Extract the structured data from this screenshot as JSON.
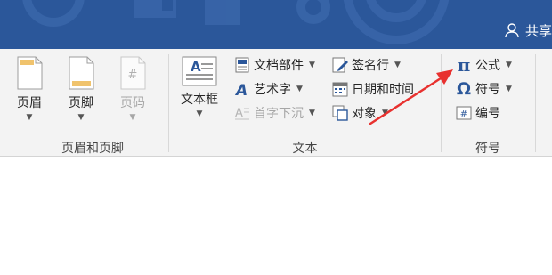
{
  "titlebar": {
    "share_label": "共享",
    "accent": "#2b579a"
  },
  "ribbon": {
    "groups": [
      {
        "label": "页眉和页脚",
        "buttons": [
          {
            "label": "页眉",
            "icon": "header-page-icon",
            "enabled": true
          },
          {
            "label": "页脚",
            "icon": "footer-page-icon",
            "enabled": true
          },
          {
            "label": "页码",
            "icon": "page-number-icon",
            "enabled": false
          }
        ]
      },
      {
        "label": "文本",
        "textbox": {
          "label": "文本框",
          "icon": "textbox-icon"
        },
        "items": [
          {
            "label": "文档部件",
            "icon": "quick-parts-icon",
            "dropdown": true,
            "enabled": true
          },
          {
            "label": "艺术字",
            "icon": "wordart-icon",
            "dropdown": true,
            "enabled": true
          },
          {
            "label": "首字下沉",
            "icon": "drop-cap-icon",
            "dropdown": true,
            "enabled": false
          },
          {
            "label": "签名行",
            "icon": "signature-line-icon",
            "dropdown": true,
            "enabled": true
          },
          {
            "label": "日期和时间",
            "icon": "date-time-icon",
            "dropdown": false,
            "enabled": true
          },
          {
            "label": "对象",
            "icon": "object-icon",
            "dropdown": true,
            "enabled": true
          }
        ]
      },
      {
        "label": "符号",
        "items": [
          {
            "label": "公式",
            "icon": "pi-equation-icon",
            "dropdown": true,
            "enabled": true
          },
          {
            "label": "符号",
            "icon": "omega-symbol-icon",
            "dropdown": true,
            "enabled": true
          },
          {
            "label": "编号",
            "icon": "number-icon",
            "dropdown": false,
            "enabled": true
          }
        ]
      }
    ]
  },
  "annotation": {
    "arrow_color": "#e8312f",
    "target": "公式"
  },
  "colors": {
    "ribbon_bg": "#f3f3f3",
    "icon_blue": "#2b579a",
    "disabled": "#a6a6a6"
  }
}
